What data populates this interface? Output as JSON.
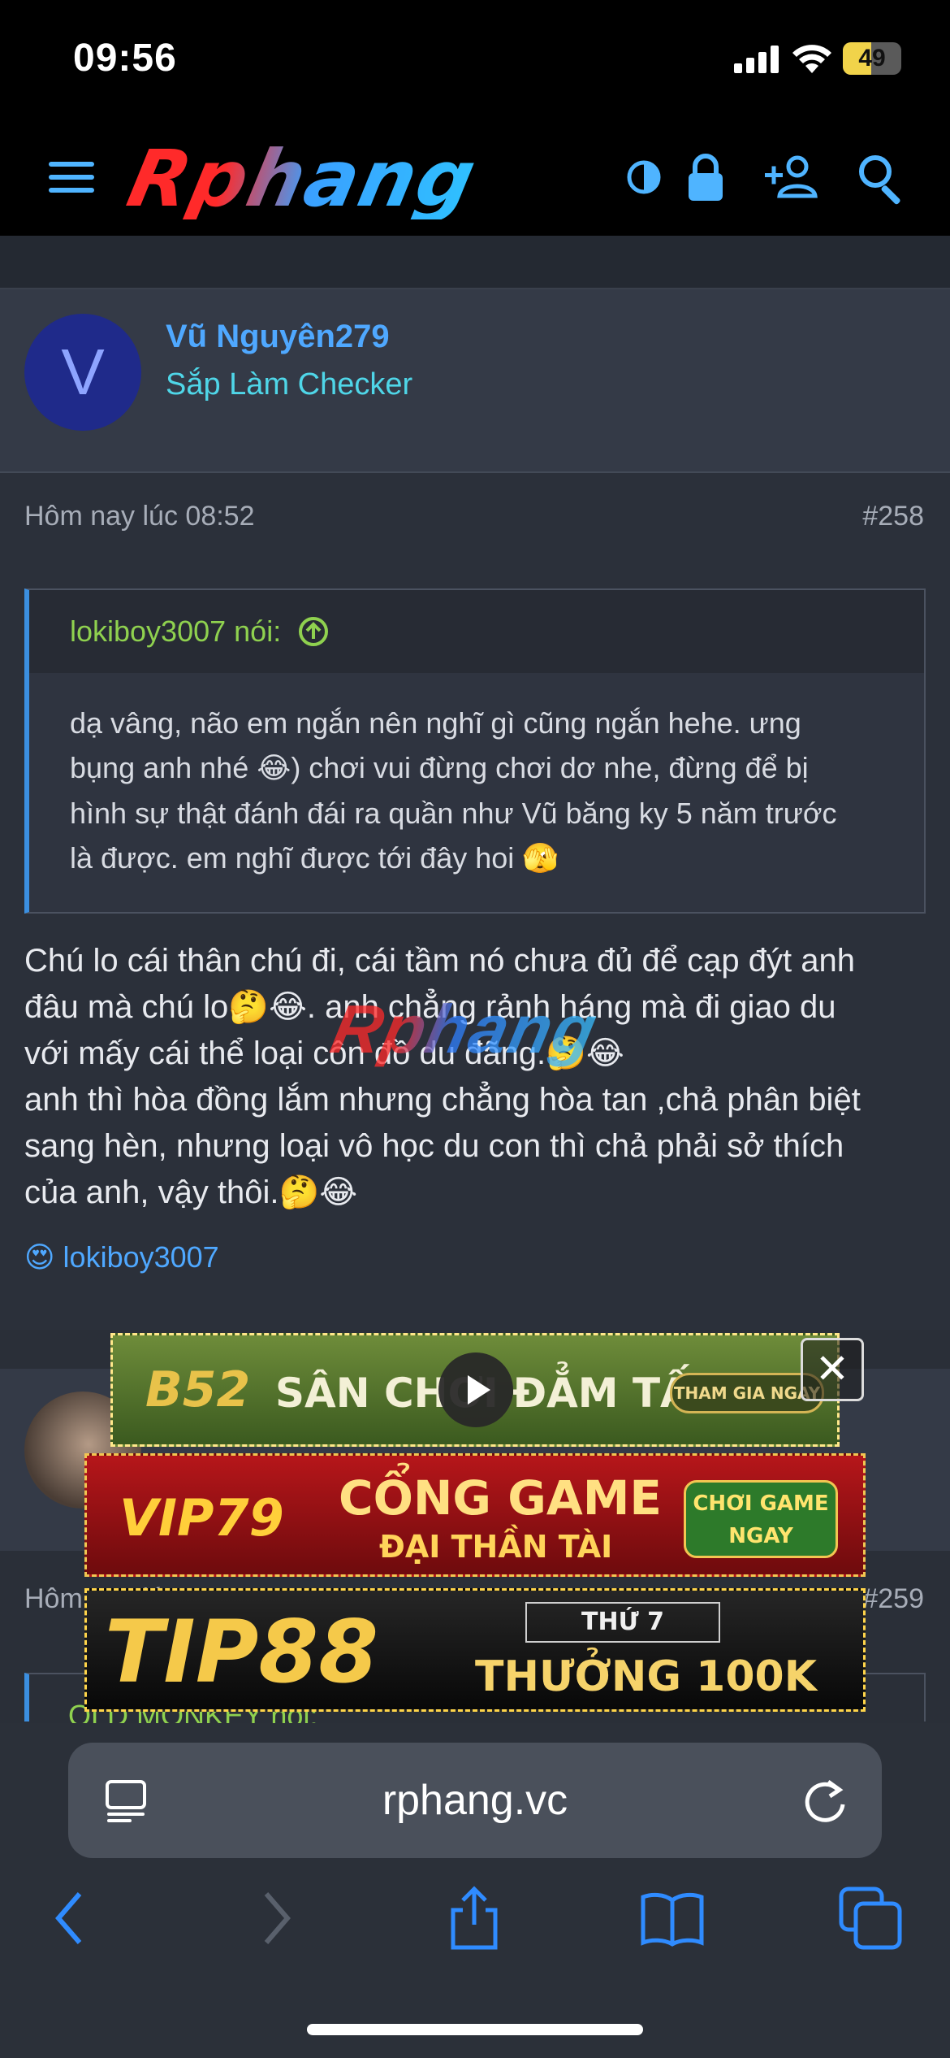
{
  "status_bar": {
    "time": "09:56",
    "battery": "49",
    "battery_level": 0.49
  },
  "header": {
    "logo": "Rphang",
    "icons": [
      "menu-icon",
      "theme-toggle-icon",
      "lock-icon",
      "register-icon",
      "search-icon"
    ]
  },
  "post1": {
    "avatar_letter": "V",
    "username": "Vũ Nguyên279",
    "user_title": "Sắp Làm Checker",
    "date": "Hôm nay lúc 08:52",
    "number": "#258",
    "quote_author": "lokiboy3007 nói:",
    "quote_text_1": "dạ vâng, não em ngắn nên nghĩ gì cũng ngắn hehe. ưng",
    "quote_text_2": "bụng anh nhé",
    "quote_text_3": ") chơi vui đừng chơi dơ nhe, đừng để bị",
    "quote_text_4": "hình sự thật đánh đái ra quần như Vũ băng ky 5 năm trước",
    "quote_text_5": "là được. em nghĩ được tới đây hoi",
    "body_1": "Chú lo cái thân chú đi, cái tầm nó chưa đủ để cạp đýt anh",
    "body_2a": "đâu mà chú lo",
    "body_2b": ". anh chẳng rảnh háng mà đi giao du",
    "body_3": "với mấy cái thể loại côn đồ du đãng.",
    "body_4": "anh thì hòa đồng lắm nhưng chẳng hòa tan ,chả phân biệt",
    "body_5": "sang hèn, nhưng loại vô học du con thì chả phải sở thích",
    "body_6": "của anh, vậy thôi.",
    "reaction_user": "lokiboy3007"
  },
  "post2": {
    "date": "Hôm nay lúc 08:53",
    "number": "#259",
    "quote_author": "OLD MONKEY nói:"
  },
  "ads": {
    "b52_brand": "B52",
    "b52_text": "SÂN CHƠI ĐẲM TẤN",
    "b52_cta": "THAM GIA NGAY",
    "vip79_brand": "VIP79",
    "vip79_title": "CỔNG GAME",
    "vip79_sub": "ĐẠI THẦN TÀI",
    "vip79_cta": "CHƠI GAME NGAY",
    "tip88_brand": "TIP88",
    "tip88_day": "THỨ 7",
    "tip88_offer": "THƯỞNG 100K",
    "close": "✕"
  },
  "browser": {
    "url": "rphang.vc"
  }
}
